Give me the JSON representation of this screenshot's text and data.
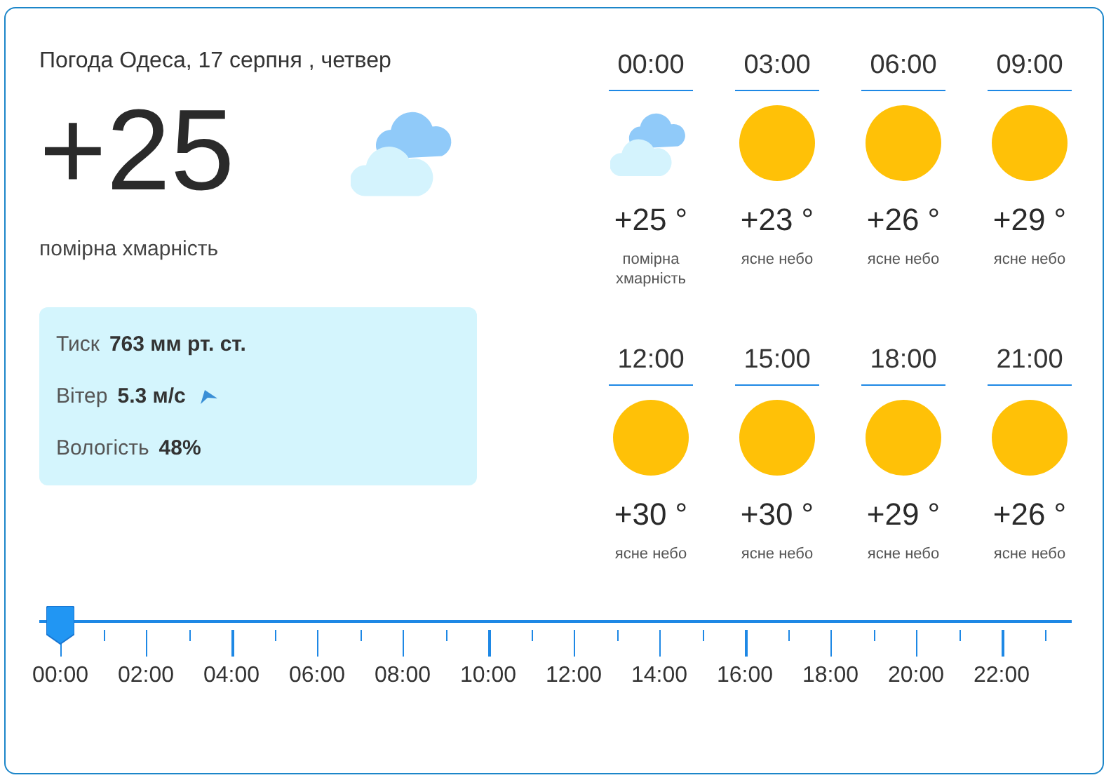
{
  "header": {
    "title": "Погода Одеса, 17 серпня , четвер"
  },
  "current": {
    "temperature": "+25",
    "kind": "cloudy",
    "description": "помірна хмарність"
  },
  "details": [
    {
      "label": "Тиск",
      "value": "763 мм рт. ст.",
      "kind": "plain"
    },
    {
      "label": "Вітер",
      "value": "5.3 м/с",
      "kind": "wind"
    },
    {
      "label": "Вологість",
      "value": "48%",
      "kind": "plain"
    }
  ],
  "hourly": [
    {
      "time": "00:00",
      "kind": "cloudy",
      "temperature": "+25 °",
      "description": "помірна хмарність"
    },
    {
      "time": "03:00",
      "kind": "clear",
      "temperature": "+23 °",
      "description": "ясне небо"
    },
    {
      "time": "06:00",
      "kind": "clear",
      "temperature": "+26 °",
      "description": "ясне небо"
    },
    {
      "time": "09:00",
      "kind": "clear",
      "temperature": "+29 °",
      "description": "ясне небо"
    },
    {
      "time": "12:00",
      "kind": "clear",
      "temperature": "+30 °",
      "description": "ясне небо"
    },
    {
      "time": "15:00",
      "kind": "clear",
      "temperature": "+30 °",
      "description": "ясне небо"
    },
    {
      "time": "18:00",
      "kind": "clear",
      "temperature": "+29 °",
      "description": "ясне небо"
    },
    {
      "time": "21:00",
      "kind": "clear",
      "temperature": "+26 °",
      "description": "ясне небо"
    }
  ],
  "timeline": {
    "level": 0,
    "labels": [
      "00:00",
      "02:00",
      "04:00",
      "06:00",
      "08:00",
      "10:00",
      "12:00",
      "14:00",
      "16:00",
      "18:00",
      "20:00",
      "22:00"
    ]
  }
}
